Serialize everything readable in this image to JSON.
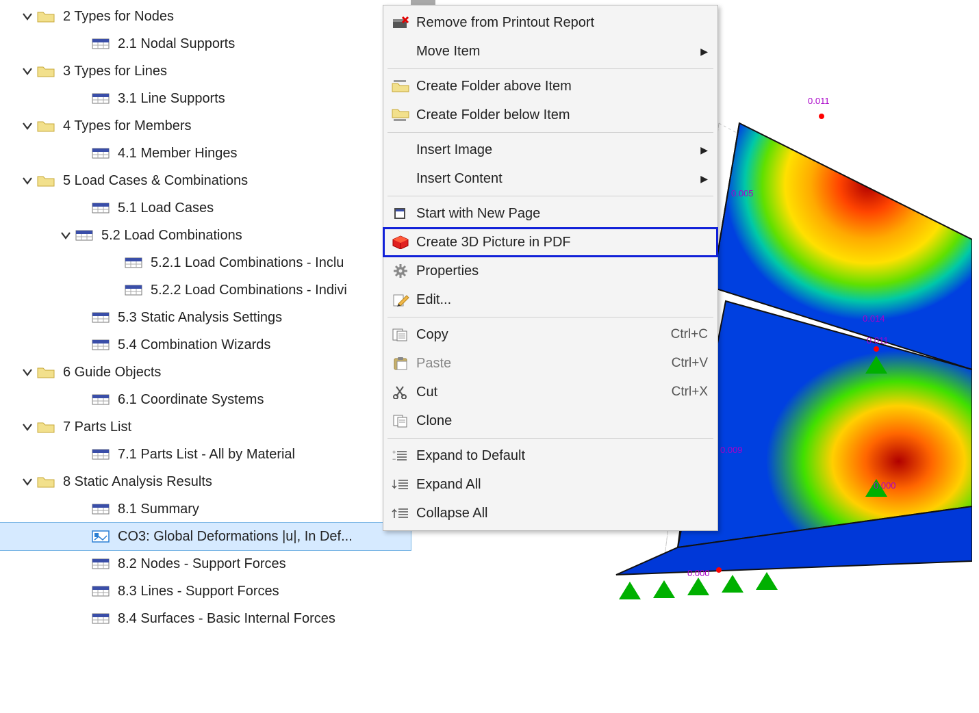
{
  "tree": [
    {
      "depth": "depth0",
      "expander": true,
      "iconType": "folder",
      "label": "2 Types for Nodes"
    },
    {
      "depth": "depth1b",
      "expander": false,
      "iconType": "table",
      "label": "2.1 Nodal Supports"
    },
    {
      "depth": "depth0",
      "expander": true,
      "iconType": "folder",
      "label": "3 Types for Lines"
    },
    {
      "depth": "depth1b",
      "expander": false,
      "iconType": "table",
      "label": "3.1 Line Supports"
    },
    {
      "depth": "depth0",
      "expander": true,
      "iconType": "folder",
      "label": "4 Types for Members"
    },
    {
      "depth": "depth1b",
      "expander": false,
      "iconType": "table",
      "label": "4.1 Member Hinges"
    },
    {
      "depth": "depth0",
      "expander": true,
      "iconType": "folder",
      "label": "5 Load Cases & Combinations"
    },
    {
      "depth": "depth1b",
      "expander": false,
      "iconType": "table",
      "label": "5.1 Load Cases"
    },
    {
      "depth": "depth1",
      "expander": true,
      "iconType": "table",
      "label": "5.2 Load Combinations"
    },
    {
      "depth": "depth2",
      "expander": false,
      "iconType": "table",
      "label": "5.2.1 Load Combinations - Inclu"
    },
    {
      "depth": "depth2",
      "expander": false,
      "iconType": "table",
      "label": "5.2.2 Load Combinations - Indivi"
    },
    {
      "depth": "depth1b",
      "expander": false,
      "iconType": "table",
      "label": "5.3 Static Analysis Settings"
    },
    {
      "depth": "depth1b",
      "expander": false,
      "iconType": "table",
      "label": "5.4 Combination Wizards"
    },
    {
      "depth": "depth0",
      "expander": true,
      "iconType": "folder",
      "label": "6 Guide Objects"
    },
    {
      "depth": "depth1b",
      "expander": false,
      "iconType": "table",
      "label": "6.1 Coordinate Systems"
    },
    {
      "depth": "depth0",
      "expander": true,
      "iconType": "folder",
      "label": "7 Parts List"
    },
    {
      "depth": "depth1b",
      "expander": false,
      "iconType": "table",
      "label": "7.1 Parts List - All by Material"
    },
    {
      "depth": "depth0",
      "expander": true,
      "iconType": "folder",
      "label": "8 Static Analysis Results"
    },
    {
      "depth": "depth1b",
      "expander": false,
      "iconType": "table",
      "label": "8.1 Summary"
    },
    {
      "depth": "depth1b",
      "expander": false,
      "iconType": "image",
      "label": "CO3: Global Deformations |u|, In Def...",
      "selected": true
    },
    {
      "depth": "depth1b",
      "expander": false,
      "iconType": "table",
      "label": "8.2 Nodes - Support Forces"
    },
    {
      "depth": "depth1b",
      "expander": false,
      "iconType": "table",
      "label": "8.3 Lines - Support Forces"
    },
    {
      "depth": "depth1b",
      "expander": false,
      "iconType": "table",
      "label": "8.4 Surfaces - Basic Internal Forces"
    }
  ],
  "menu": [
    {
      "type": "item",
      "icon": "remove",
      "label": "Remove from Printout Report"
    },
    {
      "type": "item",
      "icon": "",
      "label": "Move Item",
      "submenu": true
    },
    {
      "type": "sep"
    },
    {
      "type": "item",
      "icon": "folder-above",
      "label": "Create Folder above Item"
    },
    {
      "type": "item",
      "icon": "folder-below",
      "label": "Create Folder below Item"
    },
    {
      "type": "sep"
    },
    {
      "type": "item",
      "icon": "",
      "label": "Insert Image",
      "submenu": true
    },
    {
      "type": "item",
      "icon": "",
      "label": "Insert Content",
      "submenu": true
    },
    {
      "type": "sep"
    },
    {
      "type": "item",
      "icon": "page",
      "label": "Start with New Page"
    },
    {
      "type": "item",
      "icon": "cube3d",
      "label": "Create 3D Picture in PDF",
      "highlight": true
    },
    {
      "type": "item",
      "icon": "gear",
      "label": "Properties"
    },
    {
      "type": "item",
      "icon": "edit",
      "label": "Edit..."
    },
    {
      "type": "sep"
    },
    {
      "type": "item",
      "icon": "copy",
      "label": "Copy",
      "shortcut": "Ctrl+C"
    },
    {
      "type": "item",
      "icon": "paste",
      "label": "Paste",
      "shortcut": "Ctrl+V",
      "disabled": true
    },
    {
      "type": "item",
      "icon": "cut",
      "label": "Cut",
      "shortcut": "Ctrl+X"
    },
    {
      "type": "item",
      "icon": "clone",
      "label": "Clone"
    },
    {
      "type": "sep"
    },
    {
      "type": "item",
      "icon": "expand-default",
      "label": "Expand to Default"
    },
    {
      "type": "item",
      "icon": "expand-all",
      "label": "Expand All"
    },
    {
      "type": "item",
      "icon": "collapse-all",
      "label": "Collapse All"
    }
  ],
  "plot_values": [
    "0.011",
    "0.005",
    "0.000",
    "0.014",
    "0.011",
    "0.009",
    "0.000",
    "0.000"
  ]
}
